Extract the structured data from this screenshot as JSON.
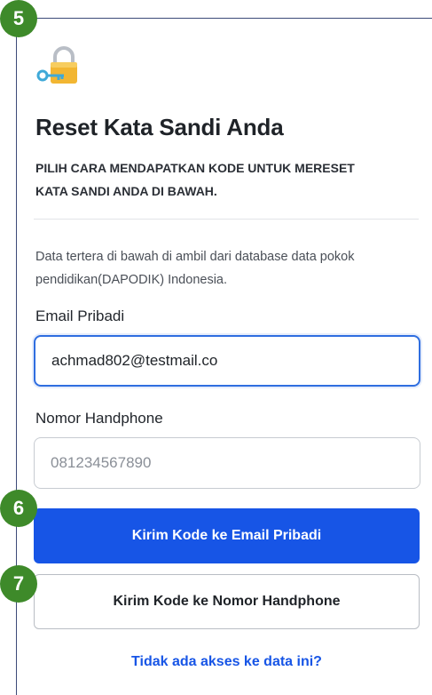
{
  "steps": {
    "step_1": "5",
    "step_2": "6",
    "step_3": "7"
  },
  "page": {
    "title": "Reset Kata Sandi Anda",
    "instruction": "PILIH CARA MENDAPATKAN KODE UNTUK MERESET KATA SANDI ANDA DI BAWAH.",
    "info": "Data tertera di bawah di ambil dari database data pokok pendidikan(DAPODIK) Indonesia."
  },
  "form": {
    "email_label": "Email Pribadi",
    "email_value": "achmad802@testmail.co",
    "phone_label": "Nomor Handphone",
    "phone_placeholder": "081234567890"
  },
  "actions": {
    "send_email_label": "Kirim Kode ke Email Pribadi",
    "send_phone_label": "Kirim Kode ke Nomor Handphone",
    "no_access_link": "Tidak ada akses ke data ini?"
  },
  "icons": {
    "header": "lock-key-icon"
  },
  "colors": {
    "primary": "#1755e6",
    "step_badge": "#3e8a2a",
    "lock_body": "#f2b632",
    "key": "#3fa9d8"
  }
}
